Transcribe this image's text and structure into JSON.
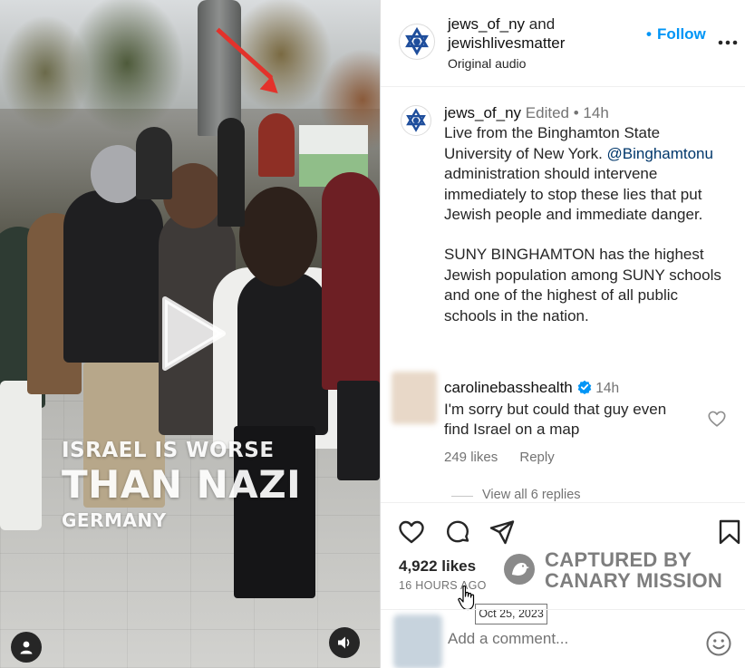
{
  "video": {
    "overlay_line1": "ISRAEL IS WORSE",
    "overlay_line2": "THAN NAZI",
    "overlay_line3": "GERMANY",
    "play_icon": "play-icon",
    "user_tag_icon": "person-icon",
    "audio_icon": "speaker-icon"
  },
  "header": {
    "author1": "jews_of_ny",
    "conjunction": "and",
    "author2": "jewishlivesmatter",
    "audio": "Original audio",
    "follow_label": "Follow",
    "more_icon": "more-horizontal-icon"
  },
  "caption": {
    "username": "jews_of_ny",
    "edited": "Edited",
    "dot": "•",
    "time": "14h",
    "p1_before": "Live from the Binghamton State University of New York.",
    "mention": "@Binghamtonu",
    "p1_after": "administration should intervene immediately to stop these lies that put Jewish people and immediate danger.",
    "p2": "SUNY BINGHAMTON has the highest Jewish population among SUNY schools and one of the highest of all public schools in the nation."
  },
  "comment": {
    "username": "carolinebasshealth",
    "verified_icon": "verified-badge-icon",
    "time": "14h",
    "text": "I'm sorry but could that guy even find Israel on a map",
    "likes": "249 likes",
    "reply_label": "Reply",
    "view_replies": "View all 6 replies"
  },
  "post": {
    "likes": "4,922 likes",
    "time_ago": "16 HOURS AGO",
    "tooltip": "Oct 25, 2023",
    "add_comment_placeholder": "Add a comment...",
    "icons": [
      "heart-icon",
      "comment-icon",
      "share-icon",
      "bookmark-icon",
      "emoji-icon"
    ]
  },
  "watermark": {
    "line1": "CAPTURED BY",
    "line2": "CANARY MISSION"
  },
  "colors": {
    "link_blue": "#0095f6",
    "mention_blue": "#00376b",
    "secondary_text": "#737373",
    "annotation_red": "#e3322b"
  }
}
